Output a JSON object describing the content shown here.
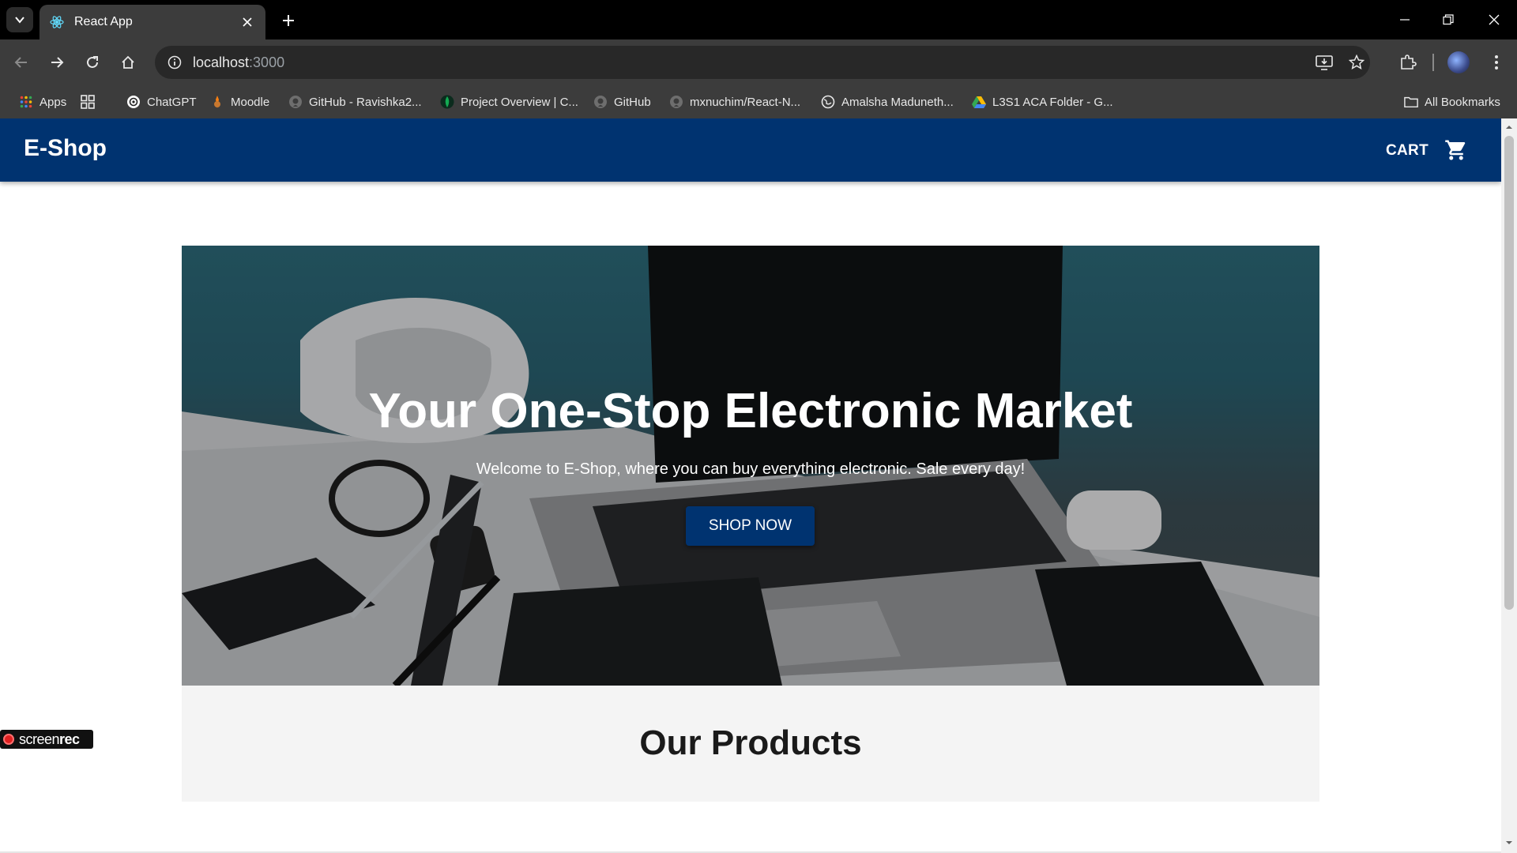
{
  "browser": {
    "tab_title": "React App",
    "url_host": "localhost",
    "url_port": ":3000",
    "bookmarks": [
      {
        "label": "Apps",
        "icon": "apps-grid-icon"
      },
      {
        "label": "",
        "icon": "tab-groups-icon"
      },
      {
        "label": "ChatGPT",
        "icon": "chatgpt-icon"
      },
      {
        "label": "Moodle",
        "icon": "moodle-icon"
      },
      {
        "label": "GitHub - Ravishka2...",
        "icon": "github-icon"
      },
      {
        "label": "Project Overview | C...",
        "icon": "mongodb-icon"
      },
      {
        "label": "GitHub",
        "icon": "github-icon"
      },
      {
        "label": "mxnuchim/React-N...",
        "icon": "github-icon"
      },
      {
        "label": "Amalsha Maduneth...",
        "icon": "globe-icon"
      },
      {
        "label": "L3S1 ACA Folder - G...",
        "icon": "google-drive-icon"
      }
    ],
    "all_bookmarks_label": "All Bookmarks"
  },
  "app": {
    "brand": "E-Shop",
    "cart_label": "CART",
    "hero": {
      "title": "Your One-Stop Electronic Market",
      "subtitle": "Welcome to E-Shop, where you can buy everything electronic. Sale every day!",
      "cta": "SHOP NOW"
    },
    "products_heading": "Our Products"
  },
  "overlay": {
    "screenrec_a": "screen",
    "screenrec_b": "rec"
  },
  "colors": {
    "appbar": "#003370",
    "button": "#003370",
    "chrome_dark": "#3c3c3c"
  }
}
